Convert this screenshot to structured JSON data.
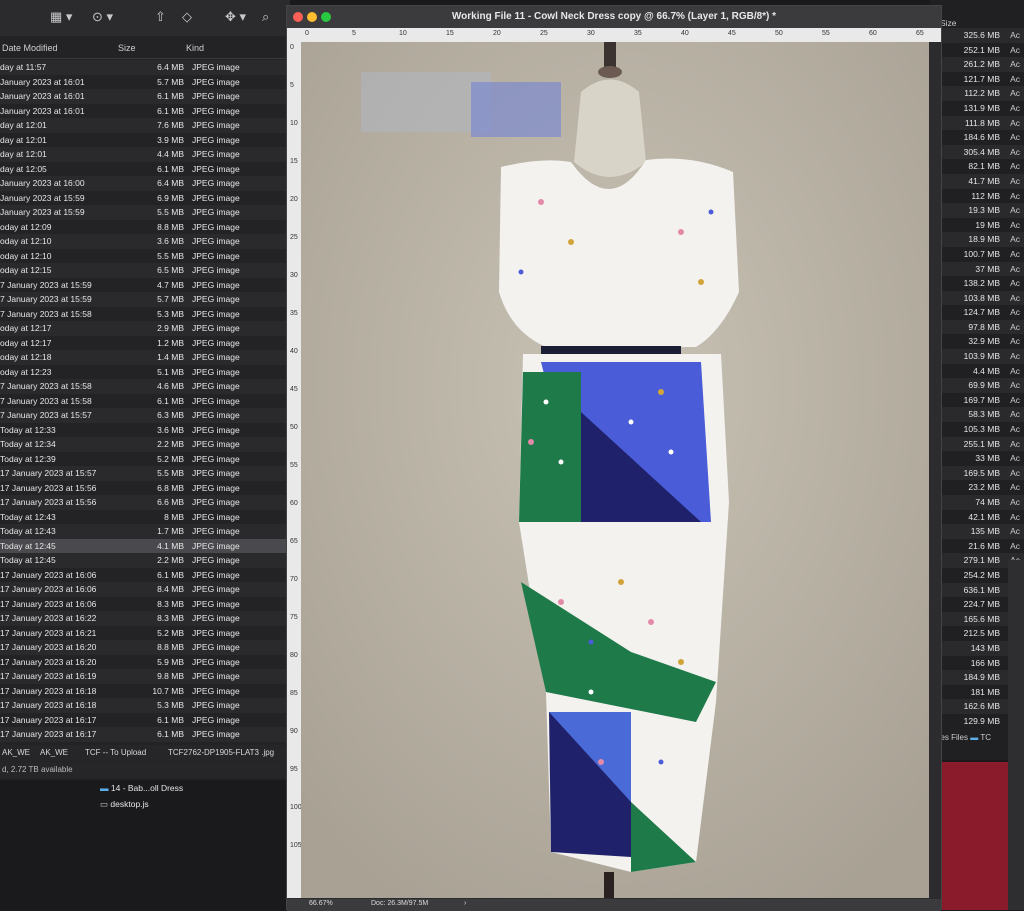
{
  "finder": {
    "header": {
      "date_modified": "Date Modified",
      "size": "Size",
      "kind": "Kind"
    },
    "rows": [
      {
        "date": "day at 11:57",
        "size": "6.4 MB",
        "kind": "JPEG image"
      },
      {
        "date": "January 2023 at 16:01",
        "size": "5.7 MB",
        "kind": "JPEG image"
      },
      {
        "date": "January 2023 at 16:01",
        "size": "6.1 MB",
        "kind": "JPEG image"
      },
      {
        "date": "January 2023 at 16:01",
        "size": "6.1 MB",
        "kind": "JPEG image"
      },
      {
        "date": "day at 12:01",
        "size": "7.6 MB",
        "kind": "JPEG image"
      },
      {
        "date": "day at 12:01",
        "size": "3.9 MB",
        "kind": "JPEG image"
      },
      {
        "date": "day at 12:01",
        "size": "4.4 MB",
        "kind": "JPEG image"
      },
      {
        "date": "day at 12:05",
        "size": "6.1 MB",
        "kind": "JPEG image"
      },
      {
        "date": "January 2023 at 16:00",
        "size": "6.4 MB",
        "kind": "JPEG image"
      },
      {
        "date": "January 2023 at 15:59",
        "size": "6.9 MB",
        "kind": "JPEG image"
      },
      {
        "date": "January 2023 at 15:59",
        "size": "5.5 MB",
        "kind": "JPEG image"
      },
      {
        "date": "oday at 12:09",
        "size": "8.8 MB",
        "kind": "JPEG image"
      },
      {
        "date": "oday at 12:10",
        "size": "3.6 MB",
        "kind": "JPEG image"
      },
      {
        "date": "oday at 12:10",
        "size": "5.5 MB",
        "kind": "JPEG image"
      },
      {
        "date": "oday at 12:15",
        "size": "6.5 MB",
        "kind": "JPEG image"
      },
      {
        "date": "7 January 2023 at 15:59",
        "size": "4.7 MB",
        "kind": "JPEG image"
      },
      {
        "date": "7 January 2023 at 15:59",
        "size": "5.7 MB",
        "kind": "JPEG image"
      },
      {
        "date": "7 January 2023 at 15:58",
        "size": "5.3 MB",
        "kind": "JPEG image"
      },
      {
        "date": "oday at 12:17",
        "size": "2.9 MB",
        "kind": "JPEG image"
      },
      {
        "date": "oday at 12:17",
        "size": "1.2 MB",
        "kind": "JPEG image"
      },
      {
        "date": "oday at 12:18",
        "size": "1.4 MB",
        "kind": "JPEG image"
      },
      {
        "date": "oday at 12:23",
        "size": "5.1 MB",
        "kind": "JPEG image"
      },
      {
        "date": "7 January 2023 at 15:58",
        "size": "4.6 MB",
        "kind": "JPEG image"
      },
      {
        "date": "7 January 2023 at 15:58",
        "size": "6.1 MB",
        "kind": "JPEG image"
      },
      {
        "date": "7 January 2023 at 15:57",
        "size": "6.3 MB",
        "kind": "JPEG image"
      },
      {
        "date": "Today at 12:33",
        "size": "3.6 MB",
        "kind": "JPEG image"
      },
      {
        "date": "Today at 12:34",
        "size": "2.2 MB",
        "kind": "JPEG image"
      },
      {
        "date": "Today at 12:39",
        "size": "5.2 MB",
        "kind": "JPEG image"
      },
      {
        "date": "17 January 2023 at 15:57",
        "size": "5.5 MB",
        "kind": "JPEG image"
      },
      {
        "date": "17 January 2023 at 15:56",
        "size": "6.8 MB",
        "kind": "JPEG image"
      },
      {
        "date": "17 January 2023 at 15:56",
        "size": "6.6 MB",
        "kind": "JPEG image"
      },
      {
        "date": "Today at 12:43",
        "size": "8 MB",
        "kind": "JPEG image"
      },
      {
        "date": "Today at 12:43",
        "size": "1.7 MB",
        "kind": "JPEG image"
      },
      {
        "date": "Today at 12:45",
        "size": "4.1 MB",
        "kind": "JPEG image"
      },
      {
        "date": "Today at 12:45",
        "size": "2.2 MB",
        "kind": "JPEG image"
      },
      {
        "date": "17 January 2023 at 16:06",
        "size": "6.1 MB",
        "kind": "JPEG image"
      },
      {
        "date": "17 January 2023 at 16:06",
        "size": "8.4 MB",
        "kind": "JPEG image"
      },
      {
        "date": "17 January 2023 at 16:06",
        "size": "8.3 MB",
        "kind": "JPEG image"
      },
      {
        "date": "17 January 2023 at 16:22",
        "size": "8.3 MB",
        "kind": "JPEG image"
      },
      {
        "date": "17 January 2023 at 16:21",
        "size": "5.2 MB",
        "kind": "JPEG image"
      },
      {
        "date": "17 January 2023 at 16:20",
        "size": "8.8 MB",
        "kind": "JPEG image"
      },
      {
        "date": "17 January 2023 at 16:20",
        "size": "5.9 MB",
        "kind": "JPEG image"
      },
      {
        "date": "17 January 2023 at 16:19",
        "size": "9.8 MB",
        "kind": "JPEG image"
      },
      {
        "date": "17 January 2023 at 16:18",
        "size": "10.7 MB",
        "kind": "JPEG image"
      },
      {
        "date": "17 January 2023 at 16:18",
        "size": "5.3 MB",
        "kind": "JPEG image"
      },
      {
        "date": "17 January 2023 at 16:17",
        "size": "6.1 MB",
        "kind": "JPEG image"
      },
      {
        "date": "17 January 2023 at 16:17",
        "size": "6.1 MB",
        "kind": "JPEG image"
      }
    ],
    "selected_index": 33,
    "path": [
      "AK_WE",
      "AK_WE",
      "TCF -- To Upload",
      "TCF2762-DP1905-FLAT3 .jpg"
    ],
    "status": "d, 2.72 TB available"
  },
  "desktop_items": [
    {
      "name": "14 - Bab...oll Dress",
      "icon": "folder-icon"
    },
    {
      "name": "desktop.js",
      "icon": "js-file-icon"
    }
  ],
  "photoshop": {
    "title": "Working File 11 - Cowl Neck Dress copy @ 66.7% (Layer 1, RGB/8*) *",
    "ruler_top": [
      "0",
      "5",
      "10",
      "15",
      "20",
      "25",
      "30",
      "35",
      "40",
      "45",
      "50",
      "55",
      "60",
      "65"
    ],
    "ruler_left": [
      "0",
      "5",
      "10",
      "15",
      "20",
      "25",
      "30",
      "35",
      "40",
      "45",
      "50",
      "55",
      "60",
      "65",
      "70",
      "75",
      "80",
      "85",
      "90",
      "95",
      "100",
      "105"
    ],
    "zoom": "66.67%",
    "doc_info": "Doc: 26.3M/97.5M"
  },
  "right_finder": {
    "header": "Size",
    "sizes": [
      "325.6 MB",
      "252.1 MB",
      "261.2 MB",
      "121.7 MB",
      "112.2 MB",
      "131.9 MB",
      "111.8 MB",
      "184.6 MB",
      "305.4 MB",
      "82.1 MB",
      "41.7 MB",
      "112 MB",
      "19.3 MB",
      "19 MB",
      "18.9 MB",
      "100.7 MB",
      "37 MB",
      "138.2 MB",
      "103.8 MB",
      "124.7 MB",
      "97.8 MB",
      "32.9 MB",
      "103.9 MB",
      "4.4 MB",
      "69.9 MB",
      "169.7 MB",
      "58.3 MB",
      "105.3 MB",
      "255.1 MB",
      "33 MB",
      "169.5 MB",
      "23.2 MB",
      "74 MB",
      "42.1 MB",
      "135 MB",
      "21.6 MB",
      "279.1 MB",
      "254.2 MB",
      "636.1 MB",
      "224.7 MB",
      "165.6 MB",
      "212.5 MB",
      "143 MB",
      "166 MB",
      "184.9 MB",
      "181 MB",
      "162.6 MB",
      "129.9 MB"
    ],
    "kind_abbr": "Ac",
    "footer": "-Res Files",
    "footer2": "TC"
  }
}
